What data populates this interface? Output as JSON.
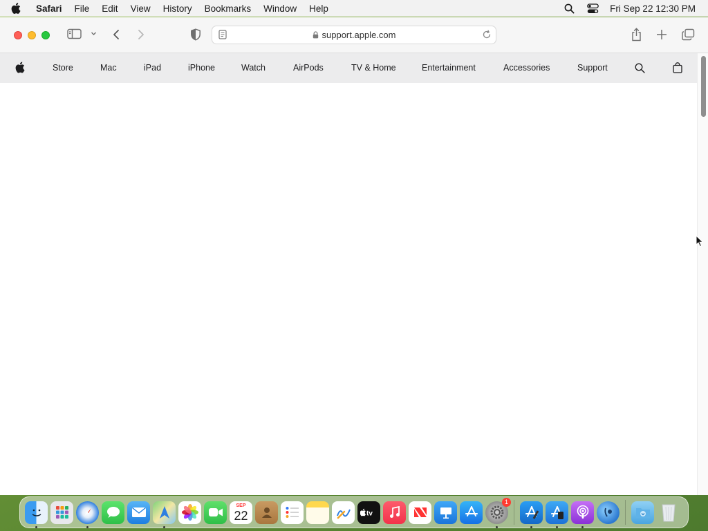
{
  "menubar": {
    "app_name": "Safari",
    "items": [
      "File",
      "Edit",
      "View",
      "History",
      "Bookmarks",
      "Window",
      "Help"
    ],
    "clock": "Fri Sep 22  12:30 PM"
  },
  "browser": {
    "url": "support.apple.com"
  },
  "apple_nav": {
    "items": [
      "Store",
      "Mac",
      "iPad",
      "iPhone",
      "Watch",
      "AirPods",
      "TV & Home",
      "Entertainment",
      "Accessories",
      "Support"
    ]
  },
  "dock": {
    "calendar_month": "SEP",
    "calendar_day": "22",
    "settings_badge": "1",
    "apps": [
      "Finder",
      "Launchpad",
      "Safari",
      "Messages",
      "Mail",
      "Maps",
      "Photos",
      "FaceTime",
      "Calendar",
      "Contacts",
      "Reminders",
      "Notes",
      "Freeform",
      "TV",
      "Music",
      "News",
      "Keynote",
      "App Store",
      "System Settings",
      "Xcode",
      "Simulator",
      "Podcasts",
      "Migration",
      "Downloads",
      "Trash"
    ]
  }
}
